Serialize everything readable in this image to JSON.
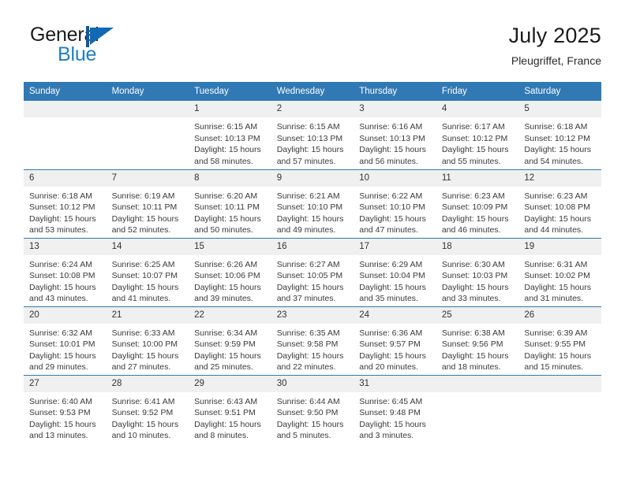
{
  "brand": {
    "name_part1": "General",
    "name_part2": "Blue",
    "flag_icon": "blue-flag-logo"
  },
  "header": {
    "title": "July 2025",
    "location": "Pleugriffet, France"
  },
  "colors": {
    "header_blue": "#3079b5",
    "brand_blue": "#1c7fc4",
    "daynum_band": "#f0f0f0",
    "text": "#3a3a3a"
  },
  "weekdays": [
    "Sunday",
    "Monday",
    "Tuesday",
    "Wednesday",
    "Thursday",
    "Friday",
    "Saturday"
  ],
  "weeks": [
    [
      {
        "day": "",
        "empty": true
      },
      {
        "day": "",
        "empty": true
      },
      {
        "day": "1",
        "sunrise": "Sunrise: 6:15 AM",
        "sunset": "Sunset: 10:13 PM",
        "daylight": "Daylight: 15 hours and 58 minutes."
      },
      {
        "day": "2",
        "sunrise": "Sunrise: 6:15 AM",
        "sunset": "Sunset: 10:13 PM",
        "daylight": "Daylight: 15 hours and 57 minutes."
      },
      {
        "day": "3",
        "sunrise": "Sunrise: 6:16 AM",
        "sunset": "Sunset: 10:13 PM",
        "daylight": "Daylight: 15 hours and 56 minutes."
      },
      {
        "day": "4",
        "sunrise": "Sunrise: 6:17 AM",
        "sunset": "Sunset: 10:12 PM",
        "daylight": "Daylight: 15 hours and 55 minutes."
      },
      {
        "day": "5",
        "sunrise": "Sunrise: 6:18 AM",
        "sunset": "Sunset: 10:12 PM",
        "daylight": "Daylight: 15 hours and 54 minutes."
      }
    ],
    [
      {
        "day": "6",
        "sunrise": "Sunrise: 6:18 AM",
        "sunset": "Sunset: 10:12 PM",
        "daylight": "Daylight: 15 hours and 53 minutes."
      },
      {
        "day": "7",
        "sunrise": "Sunrise: 6:19 AM",
        "sunset": "Sunset: 10:11 PM",
        "daylight": "Daylight: 15 hours and 52 minutes."
      },
      {
        "day": "8",
        "sunrise": "Sunrise: 6:20 AM",
        "sunset": "Sunset: 10:11 PM",
        "daylight": "Daylight: 15 hours and 50 minutes."
      },
      {
        "day": "9",
        "sunrise": "Sunrise: 6:21 AM",
        "sunset": "Sunset: 10:10 PM",
        "daylight": "Daylight: 15 hours and 49 minutes."
      },
      {
        "day": "10",
        "sunrise": "Sunrise: 6:22 AM",
        "sunset": "Sunset: 10:10 PM",
        "daylight": "Daylight: 15 hours and 47 minutes."
      },
      {
        "day": "11",
        "sunrise": "Sunrise: 6:23 AM",
        "sunset": "Sunset: 10:09 PM",
        "daylight": "Daylight: 15 hours and 46 minutes."
      },
      {
        "day": "12",
        "sunrise": "Sunrise: 6:23 AM",
        "sunset": "Sunset: 10:08 PM",
        "daylight": "Daylight: 15 hours and 44 minutes."
      }
    ],
    [
      {
        "day": "13",
        "sunrise": "Sunrise: 6:24 AM",
        "sunset": "Sunset: 10:08 PM",
        "daylight": "Daylight: 15 hours and 43 minutes."
      },
      {
        "day": "14",
        "sunrise": "Sunrise: 6:25 AM",
        "sunset": "Sunset: 10:07 PM",
        "daylight": "Daylight: 15 hours and 41 minutes."
      },
      {
        "day": "15",
        "sunrise": "Sunrise: 6:26 AM",
        "sunset": "Sunset: 10:06 PM",
        "daylight": "Daylight: 15 hours and 39 minutes."
      },
      {
        "day": "16",
        "sunrise": "Sunrise: 6:27 AM",
        "sunset": "Sunset: 10:05 PM",
        "daylight": "Daylight: 15 hours and 37 minutes."
      },
      {
        "day": "17",
        "sunrise": "Sunrise: 6:29 AM",
        "sunset": "Sunset: 10:04 PM",
        "daylight": "Daylight: 15 hours and 35 minutes."
      },
      {
        "day": "18",
        "sunrise": "Sunrise: 6:30 AM",
        "sunset": "Sunset: 10:03 PM",
        "daylight": "Daylight: 15 hours and 33 minutes."
      },
      {
        "day": "19",
        "sunrise": "Sunrise: 6:31 AM",
        "sunset": "Sunset: 10:02 PM",
        "daylight": "Daylight: 15 hours and 31 minutes."
      }
    ],
    [
      {
        "day": "20",
        "sunrise": "Sunrise: 6:32 AM",
        "sunset": "Sunset: 10:01 PM",
        "daylight": "Daylight: 15 hours and 29 minutes."
      },
      {
        "day": "21",
        "sunrise": "Sunrise: 6:33 AM",
        "sunset": "Sunset: 10:00 PM",
        "daylight": "Daylight: 15 hours and 27 minutes."
      },
      {
        "day": "22",
        "sunrise": "Sunrise: 6:34 AM",
        "sunset": "Sunset: 9:59 PM",
        "daylight": "Daylight: 15 hours and 25 minutes."
      },
      {
        "day": "23",
        "sunrise": "Sunrise: 6:35 AM",
        "sunset": "Sunset: 9:58 PM",
        "daylight": "Daylight: 15 hours and 22 minutes."
      },
      {
        "day": "24",
        "sunrise": "Sunrise: 6:36 AM",
        "sunset": "Sunset: 9:57 PM",
        "daylight": "Daylight: 15 hours and 20 minutes."
      },
      {
        "day": "25",
        "sunrise": "Sunrise: 6:38 AM",
        "sunset": "Sunset: 9:56 PM",
        "daylight": "Daylight: 15 hours and 18 minutes."
      },
      {
        "day": "26",
        "sunrise": "Sunrise: 6:39 AM",
        "sunset": "Sunset: 9:55 PM",
        "daylight": "Daylight: 15 hours and 15 minutes."
      }
    ],
    [
      {
        "day": "27",
        "sunrise": "Sunrise: 6:40 AM",
        "sunset": "Sunset: 9:53 PM",
        "daylight": "Daylight: 15 hours and 13 minutes."
      },
      {
        "day": "28",
        "sunrise": "Sunrise: 6:41 AM",
        "sunset": "Sunset: 9:52 PM",
        "daylight": "Daylight: 15 hours and 10 minutes."
      },
      {
        "day": "29",
        "sunrise": "Sunrise: 6:43 AM",
        "sunset": "Sunset: 9:51 PM",
        "daylight": "Daylight: 15 hours and 8 minutes."
      },
      {
        "day": "30",
        "sunrise": "Sunrise: 6:44 AM",
        "sunset": "Sunset: 9:50 PM",
        "daylight": "Daylight: 15 hours and 5 minutes."
      },
      {
        "day": "31",
        "sunrise": "Sunrise: 6:45 AM",
        "sunset": "Sunset: 9:48 PM",
        "daylight": "Daylight: 15 hours and 3 minutes."
      },
      {
        "day": "",
        "empty": true
      },
      {
        "day": "",
        "empty": true
      }
    ]
  ]
}
